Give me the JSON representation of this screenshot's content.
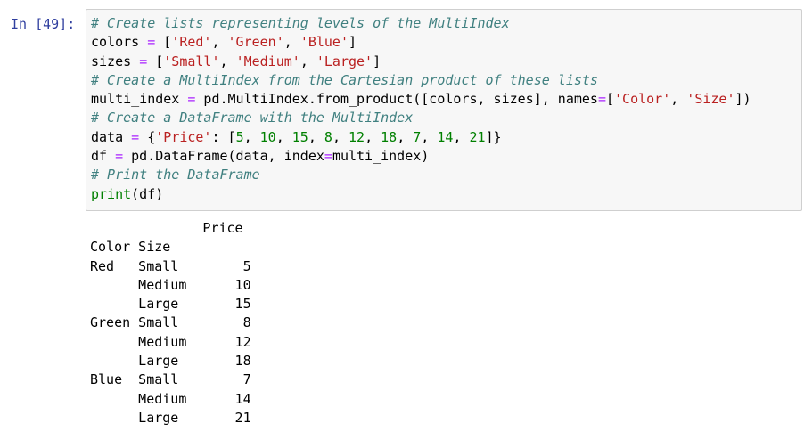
{
  "cell": {
    "prompt": "In [49]:",
    "code_lines": [
      [
        {
          "t": "cm",
          "v": "# Create lists representing levels of the MultiIndex"
        }
      ],
      [
        {
          "t": "nm",
          "v": "colors "
        },
        {
          "t": "op",
          "v": "="
        },
        {
          "t": "nm",
          "v": " ["
        },
        {
          "t": "st",
          "v": "'Red'"
        },
        {
          "t": "nm",
          "v": ", "
        },
        {
          "t": "st",
          "v": "'Green'"
        },
        {
          "t": "nm",
          "v": ", "
        },
        {
          "t": "st",
          "v": "'Blue'"
        },
        {
          "t": "nm",
          "v": "]"
        }
      ],
      [
        {
          "t": "nm",
          "v": "sizes "
        },
        {
          "t": "op",
          "v": "="
        },
        {
          "t": "nm",
          "v": " ["
        },
        {
          "t": "st",
          "v": "'Small'"
        },
        {
          "t": "nm",
          "v": ", "
        },
        {
          "t": "st",
          "v": "'Medium'"
        },
        {
          "t": "nm",
          "v": ", "
        },
        {
          "t": "st",
          "v": "'Large'"
        },
        {
          "t": "nm",
          "v": "]"
        }
      ],
      [
        {
          "t": "cm",
          "v": "# Create a MultiIndex from the Cartesian product of these lists"
        }
      ],
      [
        {
          "t": "nm",
          "v": "multi_index "
        },
        {
          "t": "op",
          "v": "="
        },
        {
          "t": "nm",
          "v": " pd.MultiIndex.from_product([colors, sizes], names"
        },
        {
          "t": "op",
          "v": "="
        },
        {
          "t": "nm",
          "v": "["
        },
        {
          "t": "st",
          "v": "'Color'"
        },
        {
          "t": "nm",
          "v": ", "
        },
        {
          "t": "st",
          "v": "'Size'"
        },
        {
          "t": "nm",
          "v": "])"
        }
      ],
      [
        {
          "t": "cm",
          "v": "# Create a DataFrame with the MultiIndex"
        }
      ],
      [
        {
          "t": "nm",
          "v": "data "
        },
        {
          "t": "op",
          "v": "="
        },
        {
          "t": "nm",
          "v": " {"
        },
        {
          "t": "st",
          "v": "'Price'"
        },
        {
          "t": "nm",
          "v": ": ["
        },
        {
          "t": "nu",
          "v": "5"
        },
        {
          "t": "nm",
          "v": ", "
        },
        {
          "t": "nu",
          "v": "10"
        },
        {
          "t": "nm",
          "v": ", "
        },
        {
          "t": "nu",
          "v": "15"
        },
        {
          "t": "nm",
          "v": ", "
        },
        {
          "t": "nu",
          "v": "8"
        },
        {
          "t": "nm",
          "v": ", "
        },
        {
          "t": "nu",
          "v": "12"
        },
        {
          "t": "nm",
          "v": ", "
        },
        {
          "t": "nu",
          "v": "18"
        },
        {
          "t": "nm",
          "v": ", "
        },
        {
          "t": "nu",
          "v": "7"
        },
        {
          "t": "nm",
          "v": ", "
        },
        {
          "t": "nu",
          "v": "14"
        },
        {
          "t": "nm",
          "v": ", "
        },
        {
          "t": "nu",
          "v": "21"
        },
        {
          "t": "nm",
          "v": "]}"
        }
      ],
      [
        {
          "t": "nm",
          "v": "df "
        },
        {
          "t": "op",
          "v": "="
        },
        {
          "t": "nm",
          "v": " pd.DataFrame(data, index"
        },
        {
          "t": "op",
          "v": "="
        },
        {
          "t": "nm",
          "v": "multi_index)"
        }
      ],
      [
        {
          "t": "cm",
          "v": "# Print the DataFrame"
        }
      ],
      [
        {
          "t": "kw",
          "v": "print"
        },
        {
          "t": "nm",
          "v": "(df)"
        }
      ]
    ],
    "output_lines": [
      "              Price",
      "Color Size         ",
      "Red   Small        5",
      "      Medium      10",
      "      Large       15",
      "Green Small        8",
      "      Medium      12",
      "      Large       18",
      "Blue  Small        7",
      "      Medium      14",
      "      Large       21"
    ]
  },
  "colors": {
    "prompt": "#303f9f",
    "comment": "#408080",
    "operator": "#aa22ff",
    "string": "#ba2121",
    "number": "#008000",
    "builtin": "#008000",
    "input_background": "#f7f7f7",
    "input_border": "#cfcfcf"
  }
}
